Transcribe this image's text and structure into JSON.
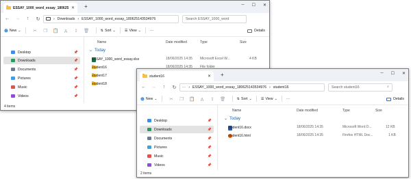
{
  "window_back": {
    "tab_title": "ESSAY_1000_word_essay_180625",
    "breadcrumb": [
      "Downloads",
      "ESSAY_1000_word_essay_180625143534976"
    ],
    "search_placeholder": "Search ESSAY_1000_word",
    "toolbar": {
      "new_label": "New",
      "sort_label": "Sort",
      "view_label": "View",
      "more_label": "···",
      "details_label": "Details"
    },
    "sidebar": [
      "Desktop",
      "Downloads",
      "Documents",
      "Pictures",
      "Music",
      "Videos"
    ],
    "columns": {
      "name": "Name",
      "date": "Date modified",
      "type": "Type",
      "size": "Size"
    },
    "group_label": "Today",
    "files": [
      {
        "name": "ESSAY_1000_word_essay.xlsx",
        "date": "18/06/2025 14:35",
        "type": "Microsoft Excel W...",
        "size": "4 KB",
        "icon": "excel-icon"
      },
      {
        "name": "student16",
        "date": "18/06/2025 14:35",
        "type": "File folder",
        "size": "",
        "icon": "folder-icon"
      },
      {
        "name": "student17",
        "date": "",
        "type": "",
        "size": "",
        "icon": "folder-icon"
      },
      {
        "name": "student18",
        "date": "",
        "type": "",
        "size": "",
        "icon": "folder-icon"
      }
    ],
    "status": "4 items"
  },
  "window_front": {
    "tab_title": "student16",
    "breadcrumb": [
      "ESSAY_1000_word_essay_180625143534976",
      "student16"
    ],
    "search_placeholder": "Search student16",
    "toolbar": {
      "new_label": "New",
      "sort_label": "Sort",
      "view_label": "View",
      "more_label": "···",
      "details_label": "Details"
    },
    "sidebar": [
      "Desktop",
      "Downloads",
      "Documents",
      "Pictures",
      "Music",
      "Videos"
    ],
    "columns": {
      "name": "Name",
      "date": "Date modified",
      "type": "Type",
      "size": "Size"
    },
    "group_label": "Today",
    "files": [
      {
        "name": "student16.docx",
        "date": "18/06/2025 14:35",
        "type": "Microsoft Word D...",
        "size": "12 KB",
        "icon": "word-icon"
      },
      {
        "name": "student16.html",
        "date": "18/06/2025 14:35",
        "type": "Firefox HTML Doc...",
        "size": "1 KB",
        "icon": "firefox-icon"
      }
    ],
    "status": "2 items"
  },
  "colors": {
    "folder": "#f5c244",
    "accent": "#1a73c9",
    "excel": "#1d6f42",
    "word": "#2b579a",
    "firefox": "#e66000",
    "selected_row": "#e3e3e3"
  }
}
